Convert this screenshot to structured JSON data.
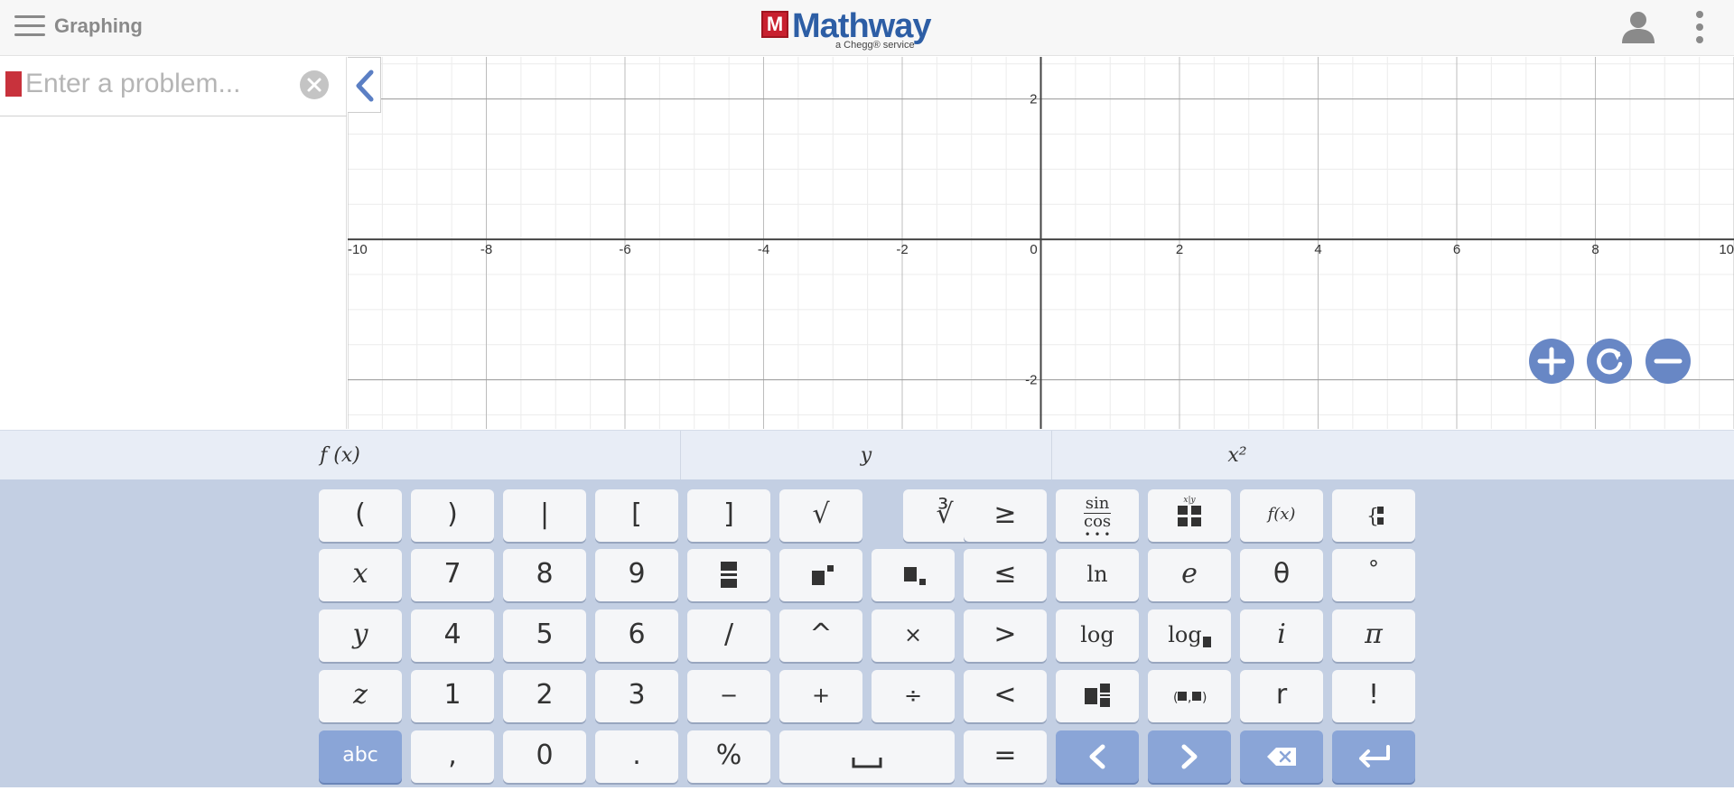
{
  "header": {
    "section_title": "Graphing",
    "logo_mark": "M",
    "logo_text": "Mathway",
    "logo_sub": "a Chegg® service"
  },
  "input": {
    "placeholder": "Enter a problem...",
    "value": ""
  },
  "graph": {
    "x_ticks": [
      "-10",
      "-8",
      "-6",
      "-4",
      "-2",
      "0",
      "2",
      "4",
      "6",
      "8",
      "10"
    ],
    "y_ticks": [
      "2",
      "-2"
    ],
    "x_range": [
      -10,
      10
    ],
    "y_range": [
      -2.7,
      2.6
    ],
    "grid": true,
    "zoom_controls": [
      "zoom-in",
      "reset",
      "zoom-out"
    ]
  },
  "func_tabs": [
    "f (x)",
    "y",
    "x²"
  ],
  "keypad": {
    "rows": [
      [
        "(",
        ")",
        "|",
        "[",
        "]",
        "√",
        "∛",
        "≥",
        "sin-cos",
        "matrix",
        "f(x)",
        "piecewise"
      ],
      [
        "x",
        "7",
        "8",
        "9",
        "fraction",
        "superscript",
        "subscript",
        "≤",
        "ln",
        "e",
        "θ",
        "°"
      ],
      [
        "y",
        "4",
        "5",
        "6",
        "/",
        "^",
        "×",
        ">",
        "log",
        "log-base",
        "i",
        "π"
      ],
      [
        "z",
        "1",
        "2",
        "3",
        "−",
        "+",
        "÷",
        "<",
        "mixed-number",
        "ordered-pair",
        "r",
        "!"
      ],
      [
        "abc",
        ",",
        "0",
        ".",
        "%",
        "space",
        "=",
        "left",
        "right",
        "backspace",
        "enter"
      ]
    ],
    "labels": {
      "open_paren": "(",
      "close_paren": ")",
      "abs": "|",
      "open_bracket": "[",
      "close_bracket": "]",
      "sqrt": "√",
      "cbrt": "∛",
      "geq": "≥",
      "sin": "sin",
      "cos": "cos",
      "fx": "f(x)",
      "x": "x",
      "seven": "7",
      "eight": "8",
      "nine": "9",
      "leq": "≤",
      "ln": "ln",
      "e": "e",
      "theta": "θ",
      "degree": "°",
      "y": "y",
      "four": "4",
      "five": "5",
      "six": "6",
      "slash": "/",
      "caret": "^",
      "times": "×",
      "gt": ">",
      "log": "log",
      "log_base": "log",
      "i": "i",
      "pi": "π",
      "z": "z",
      "one": "1",
      "two": "2",
      "three": "3",
      "minus": "−",
      "plus": "+",
      "divide": "÷",
      "lt": "<",
      "r": "r",
      "factorial": "!",
      "abc": "abc",
      "comma": ",",
      "zero": "0",
      "dot": ".",
      "percent": "%",
      "equals": "="
    }
  }
}
